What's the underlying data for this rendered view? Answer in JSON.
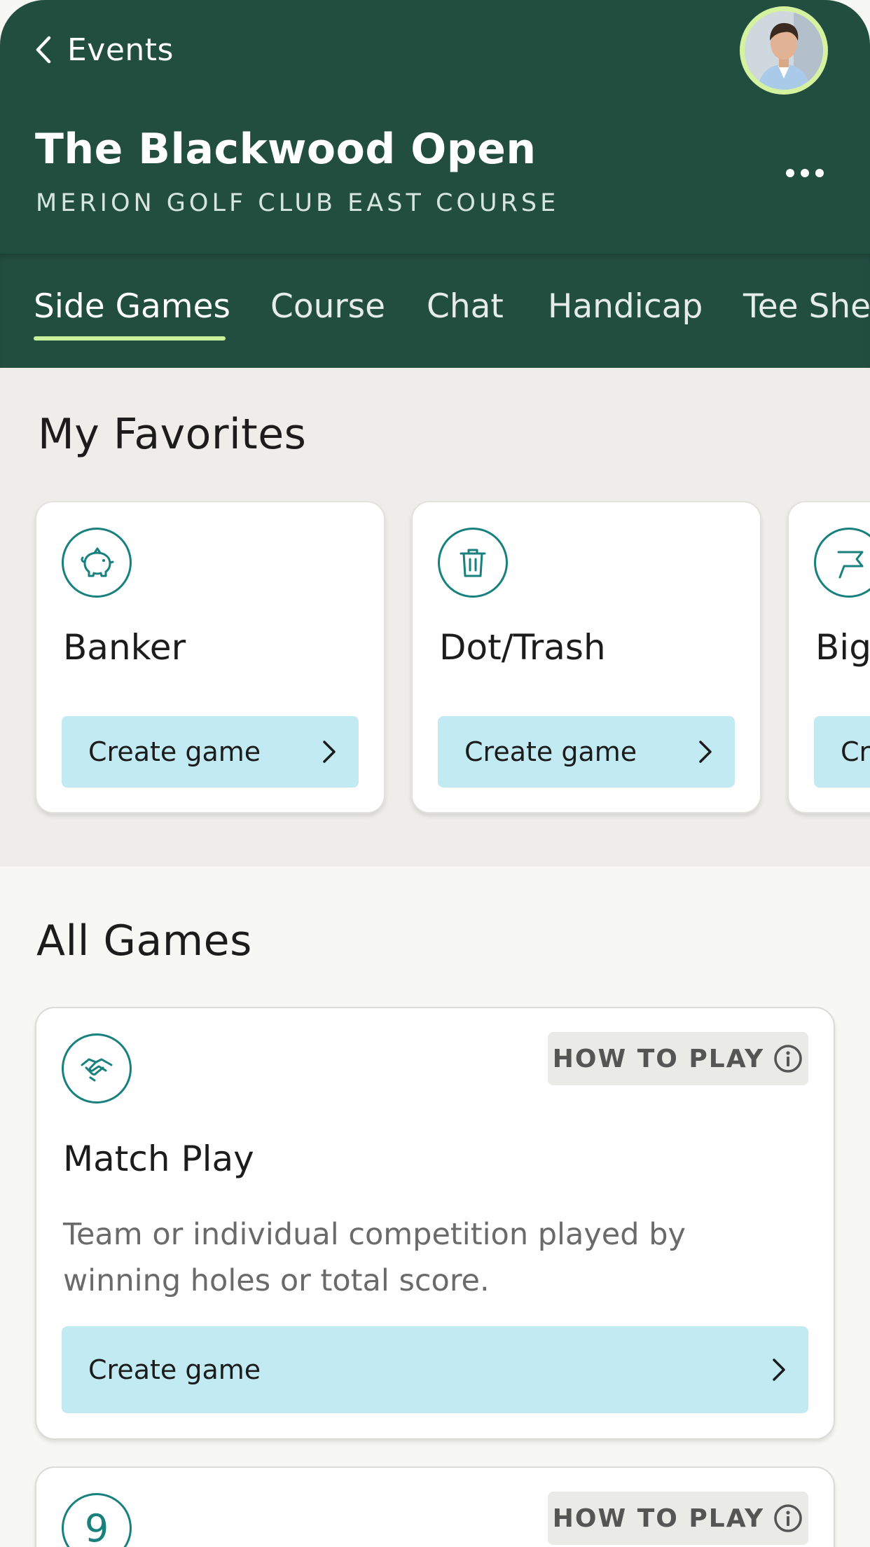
{
  "header": {
    "back_label": "Events",
    "title": "The Blackwood Open",
    "subtitle": "MERION GOLF CLUB EAST COURSE"
  },
  "tabs": [
    {
      "label": "Side Games",
      "active": true
    },
    {
      "label": "Course",
      "active": false
    },
    {
      "label": "Chat",
      "active": false
    },
    {
      "label": "Handicap",
      "active": false
    },
    {
      "label": "Tee She",
      "active": false
    }
  ],
  "favorites": {
    "title": "My Favorites",
    "cards": [
      {
        "name": "Banker",
        "icon": "piggy-bank-icon",
        "button": "Create game"
      },
      {
        "name": "Dot/Trash",
        "icon": "trash-icon",
        "button": "Create game"
      },
      {
        "name": "Big",
        "icon": "flag-icon",
        "button": "Cr"
      }
    ]
  },
  "all_games": {
    "title": "All Games",
    "games": [
      {
        "name": "Match Play",
        "icon": "handshake-icon",
        "how_to_play": "HOW TO PLAY",
        "description": "Team or individual competition played by winning holes or total score.",
        "button": "Create game"
      },
      {
        "icon": "nine-icon",
        "icon_glyph": "9",
        "how_to_play": "HOW TO PLAY"
      }
    ]
  },
  "colors": {
    "header_bg": "#224e40",
    "tab_underline": "#c9f19c",
    "accent_teal": "#18807d",
    "button_bg": "#c2eaf2"
  }
}
